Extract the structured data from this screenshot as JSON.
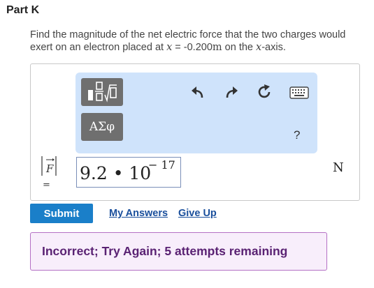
{
  "part": {
    "title": "Part K"
  },
  "question": {
    "text_before": "Find the magnitude of the net electric force that the two charges would exert on an electron placed at ",
    "variable": "x",
    "equals": " = -0.200",
    "unit_m": "m",
    "text_middle": " on the ",
    "axis_var": "x",
    "text_after": "-axis."
  },
  "toolbar": {
    "symbols_label": "ΑΣφ",
    "help_label": "?",
    "icons": [
      "templates-icon",
      "undo-icon",
      "redo-icon",
      "reset-icon",
      "keyboard-icon"
    ]
  },
  "answer": {
    "lhs_var": "F",
    "lhs_eq": "=",
    "mantissa": "9.2 • 10",
    "exponent": "− 17",
    "unit": "N"
  },
  "actions": {
    "submit_label": "Submit",
    "my_answers_label": "My Answers",
    "give_up_label": "Give Up"
  },
  "feedback": {
    "text": "Incorrect; Try Again; 5 attempts remaining"
  },
  "colors": {
    "toolbar_bg": "#cfe3fb",
    "submit_bg": "#1a7fc9",
    "link": "#1a4f9c",
    "feedback_bg": "#f8eefb",
    "feedback_border": "#b470c4",
    "feedback_text": "#5a2273"
  }
}
